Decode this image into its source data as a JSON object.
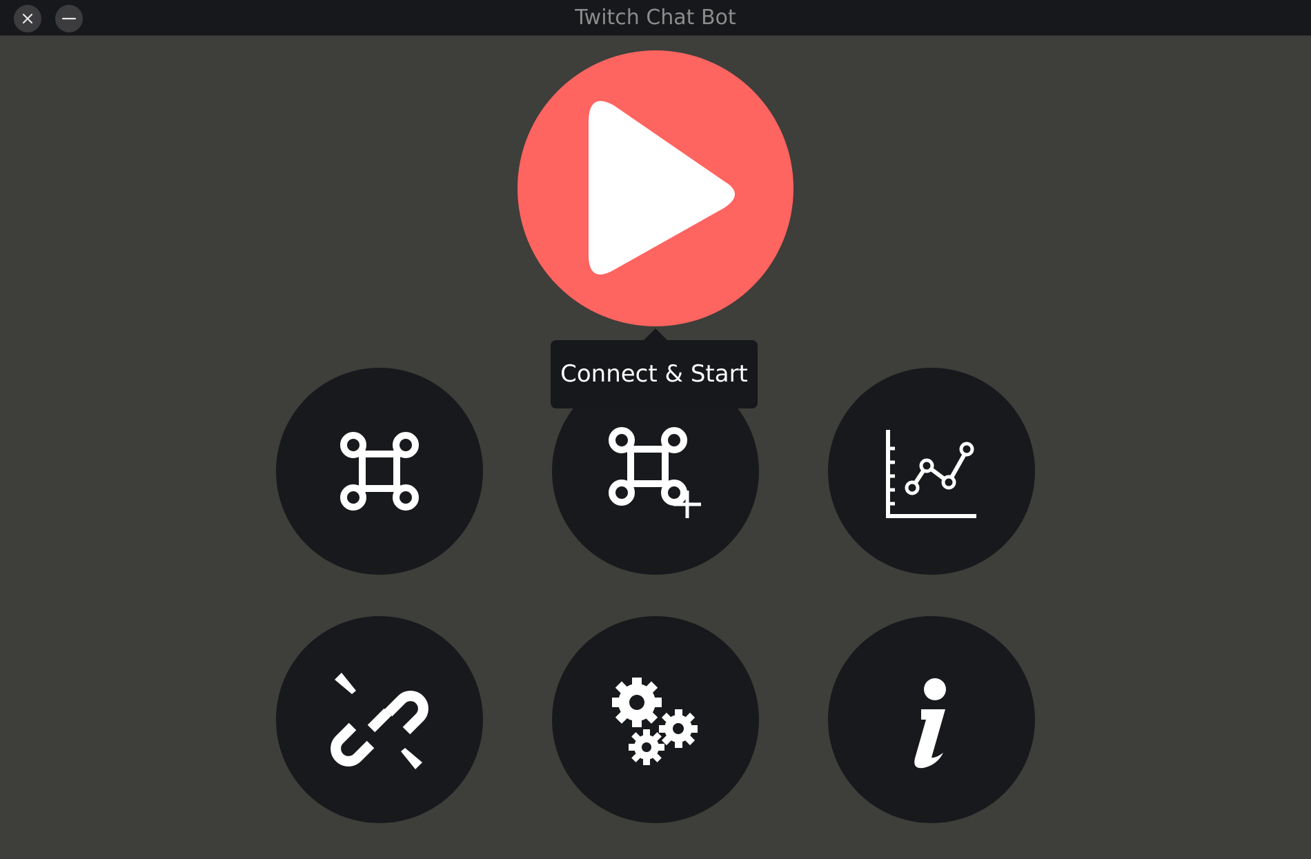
{
  "window": {
    "title": "Twitch Chat Bot"
  },
  "titlebar": {
    "close_icon": "close-icon",
    "minimize_icon": "minimize-icon"
  },
  "main": {
    "play_button": {
      "icon": "play-icon",
      "tooltip": "Connect & Start",
      "color": "#fe6460"
    },
    "buttons": [
      {
        "name": "commands",
        "icon": "command-icon"
      },
      {
        "name": "add-command",
        "icon": "command-add-icon"
      },
      {
        "name": "statistics",
        "icon": "line-chart-icon"
      },
      {
        "name": "disconnect",
        "icon": "broken-link-icon"
      },
      {
        "name": "settings",
        "icon": "gears-icon"
      },
      {
        "name": "about",
        "icon": "info-icon"
      }
    ]
  },
  "colors": {
    "background": "#3e3e3a",
    "titlebar": "#17181b",
    "button": "#18191c",
    "accent": "#fe6460",
    "icon": "#ffffff"
  }
}
